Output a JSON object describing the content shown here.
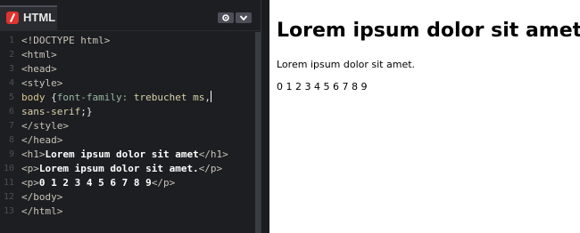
{
  "editor": {
    "tab_label": "HTML",
    "icons": {
      "logo": "html-logo-icon",
      "settings": "gear-icon",
      "collapse": "chevron-down-icon"
    },
    "line_numbers": [
      "1",
      "2",
      "3",
      "4",
      "5",
      "6",
      "7",
      "8",
      "9",
      "10",
      "11",
      "12",
      "13"
    ],
    "code": {
      "l1": "<!DOCTYPE html>",
      "l2": "<html>",
      "l3": "<head>",
      "l4": "<style>",
      "l5_selector": "body",
      "l5_brace": " {",
      "l5_prop": "font-family: ",
      "l5_val": "trebuchet ms",
      "l5_comma": ",",
      "l5b_val": "sans-serif",
      "l5b_end": ";}",
      "l6": "</style>",
      "l7": "</head>",
      "l8_open": "<h1>",
      "l8_text": "Lorem ipsum dolor sit amet",
      "l8_close": "</h1>",
      "l9_open": "<p>",
      "l9_text": "Lorem ipsum dolor sit amet.",
      "l9_close": "</p>",
      "l10_open": "<p>",
      "l10_text": "0 1 2 3 4 5 6 7 8 9",
      "l10_close": "</p>",
      "l11": "</body>",
      "l12": "</html>"
    }
  },
  "preview": {
    "heading": "Lorem ipsum dolor sit amet",
    "paragraph1": "Lorem ipsum dolor sit amet.",
    "paragraph2": "0 1 2 3 4 5 6 7 8 9"
  },
  "colors": {
    "editor_bg": "#1d1e22",
    "logo_red": "#e0342f",
    "preview_bg": "#ffffff"
  }
}
